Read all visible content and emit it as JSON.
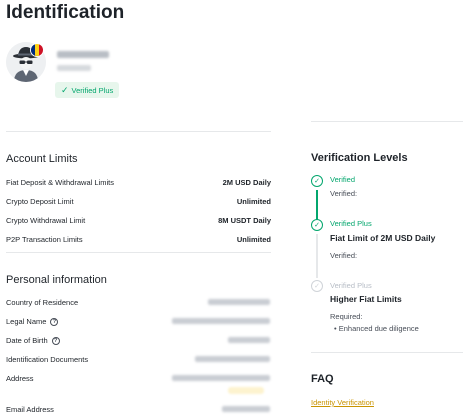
{
  "page": {
    "title": "Identification"
  },
  "profile": {
    "status_badge": "Verified Plus",
    "flag_colors": [
      "#002b7f",
      "#fcd116",
      "#ce1126"
    ]
  },
  "account_limits": {
    "title": "Account Limits",
    "rows": [
      {
        "label": "Fiat Deposit & Withdrawal Limits",
        "value": "2M USD Daily"
      },
      {
        "label": "Crypto Deposit Limit",
        "value": "Unlimited"
      },
      {
        "label": "Crypto Withdrawal Limit",
        "value": "8M USDT Daily"
      },
      {
        "label": "P2P Transaction Limits",
        "value": "Unlimited"
      }
    ]
  },
  "personal_info": {
    "title": "Personal information",
    "rows": [
      {
        "label": "Country of Residence",
        "help": false
      },
      {
        "label": "Legal Name",
        "help": true
      },
      {
        "label": "Date of Birth",
        "help": true
      },
      {
        "label": "Identification Documents",
        "help": false
      },
      {
        "label": "Address",
        "help": false
      },
      {
        "label": "Email Address",
        "help": false
      }
    ]
  },
  "verification_levels": {
    "title": "Verification Levels",
    "steps": [
      {
        "label": "Verified",
        "status": "done",
        "sub": "Verified:"
      },
      {
        "label": "Verified Plus",
        "status": "done",
        "heading": "Fiat Limit of 2M USD Daily",
        "sub": "Verified:"
      },
      {
        "label": "Verified Plus",
        "status": "pending",
        "heading": "Higher Fiat Limits",
        "sub": "Required:",
        "bullet": "Enhanced due diligence"
      }
    ]
  },
  "faq": {
    "title": "FAQ",
    "links": [
      {
        "label": "Identity Verification"
      }
    ]
  },
  "icons": {
    "check": "check-icon",
    "help": "help-circle-icon",
    "avatar": "incognito-avatar-icon"
  },
  "colors": {
    "success": "#03a66d",
    "link": "#c99400",
    "text": "#1e2329",
    "muted": "#b7bdc6"
  }
}
